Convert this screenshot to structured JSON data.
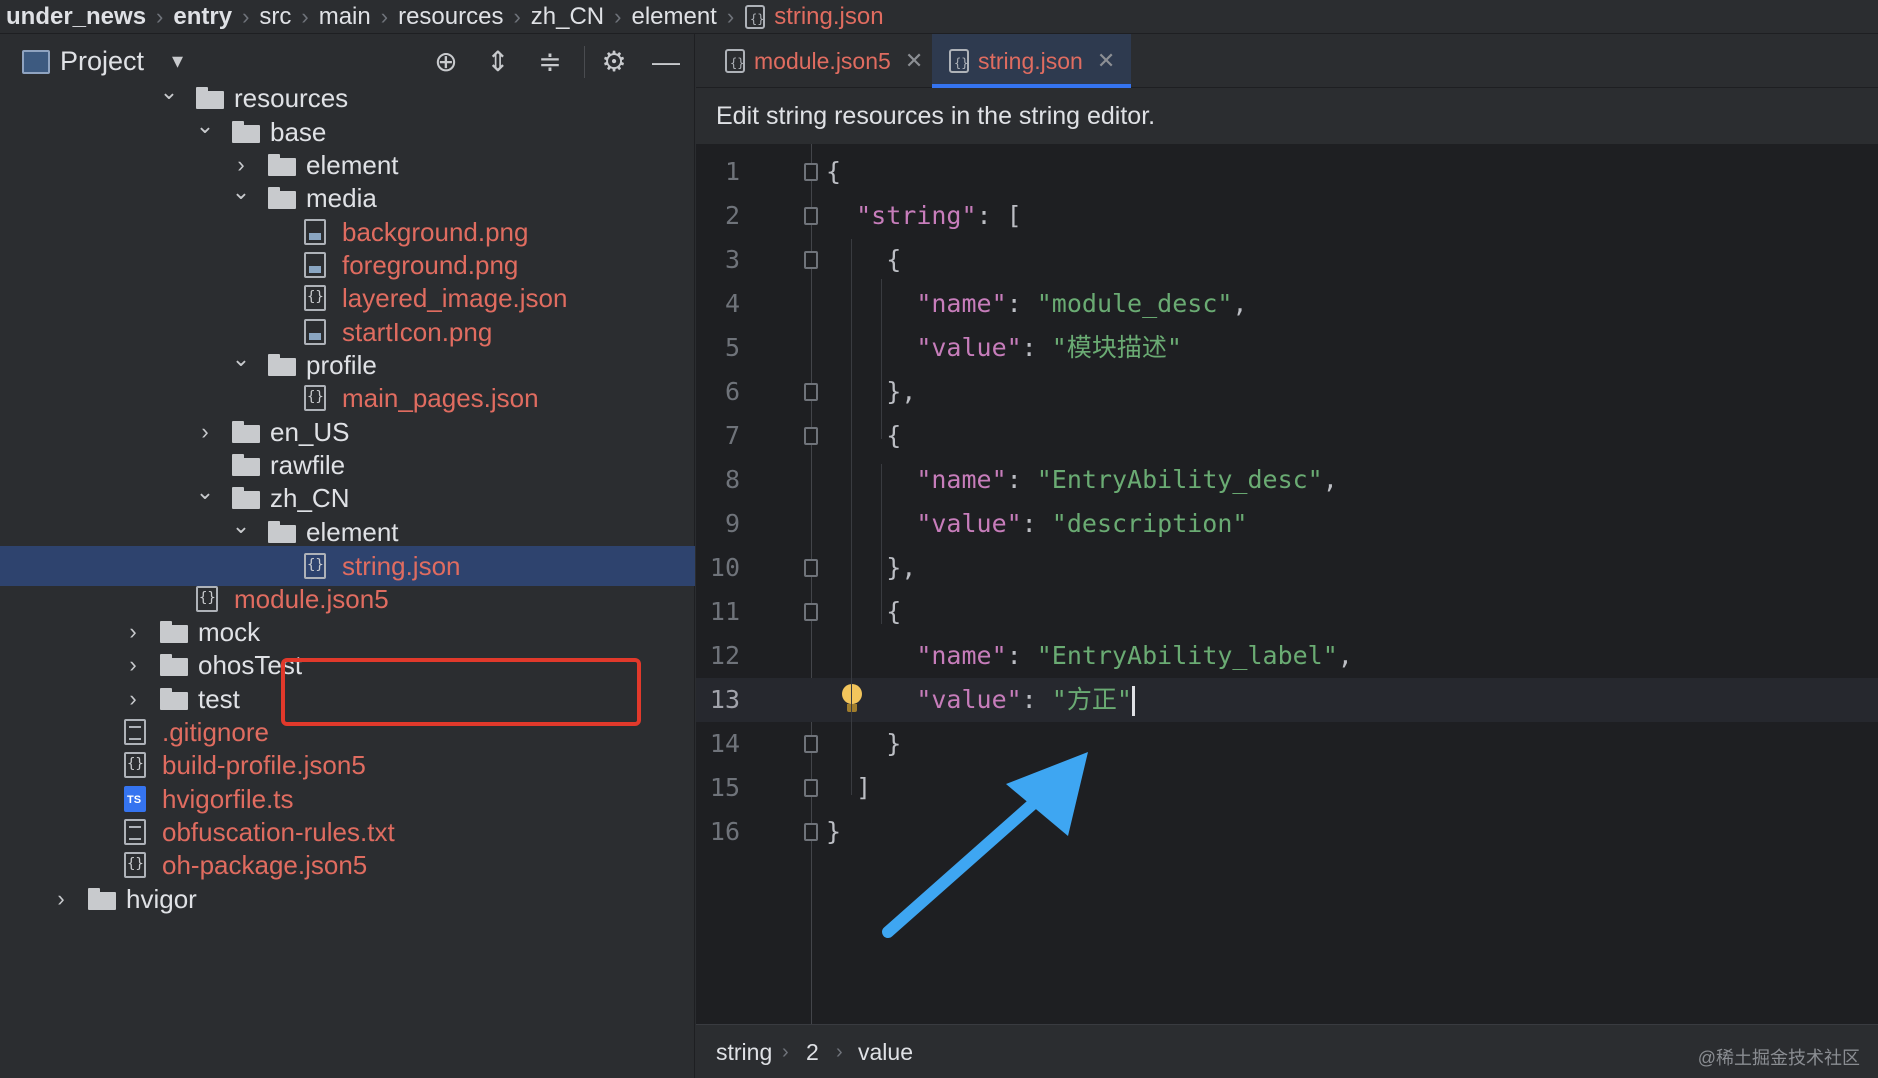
{
  "breadcrumb": {
    "items": [
      "under_news",
      "entry",
      "src",
      "main",
      "resources",
      "zh_CN",
      "element"
    ],
    "file": "string.json"
  },
  "project_panel": {
    "title": "Project",
    "tree": [
      {
        "label": "resources",
        "kind": "folder",
        "state": "expanded"
      },
      {
        "label": "base",
        "kind": "folder",
        "state": "expanded"
      },
      {
        "label": "element",
        "kind": "folder",
        "state": "collapsed"
      },
      {
        "label": "media",
        "kind": "folder",
        "state": "expanded"
      },
      {
        "label": "background.png",
        "kind": "image-file"
      },
      {
        "label": "foreground.png",
        "kind": "image-file"
      },
      {
        "label": "layered_image.json",
        "kind": "json-file"
      },
      {
        "label": "startIcon.png",
        "kind": "image-file"
      },
      {
        "label": "profile",
        "kind": "folder",
        "state": "expanded"
      },
      {
        "label": "main_pages.json",
        "kind": "json-file"
      },
      {
        "label": "en_US",
        "kind": "folder",
        "state": "collapsed"
      },
      {
        "label": "rawfile",
        "kind": "folder"
      },
      {
        "label": "zh_CN",
        "kind": "folder",
        "state": "expanded"
      },
      {
        "label": "element",
        "kind": "folder",
        "state": "expanded"
      },
      {
        "label": "string.json",
        "kind": "json-file",
        "selected": true
      },
      {
        "label": "module.json5",
        "kind": "json-file"
      },
      {
        "label": "mock",
        "kind": "folder",
        "state": "collapsed"
      },
      {
        "label": "ohosTest",
        "kind": "folder",
        "state": "collapsed"
      },
      {
        "label": "test",
        "kind": "folder",
        "state": "collapsed"
      },
      {
        "label": ".gitignore",
        "kind": "text-file"
      },
      {
        "label": "build-profile.json5",
        "kind": "json-file"
      },
      {
        "label": "hvigorfile.ts",
        "kind": "ts-file"
      },
      {
        "label": "obfuscation-rules.txt",
        "kind": "text-file"
      },
      {
        "label": "oh-package.json5",
        "kind": "json-file"
      },
      {
        "label": "hvigor",
        "kind": "folder",
        "state": "collapsed"
      }
    ]
  },
  "editor": {
    "tabs": [
      {
        "label": "module.json5",
        "active": false
      },
      {
        "label": "string.json",
        "active": true
      }
    ],
    "notice": "Edit string resources in the string editor.",
    "current_line": 13,
    "lines": [
      {
        "n": "1",
        "t": "{"
      },
      {
        "n": "2",
        "t": "  \"string\": ["
      },
      {
        "n": "3",
        "t": "    {"
      },
      {
        "n": "4",
        "t": "      \"name\": \"module_desc\","
      },
      {
        "n": "5",
        "t": "      \"value\": \"模块描述\""
      },
      {
        "n": "6",
        "t": "    },"
      },
      {
        "n": "7",
        "t": "    {"
      },
      {
        "n": "8",
        "t": "      \"name\": \"EntryAbility_desc\","
      },
      {
        "n": "9",
        "t": "      \"value\": \"description\""
      },
      {
        "n": "10",
        "t": "    },"
      },
      {
        "n": "11",
        "t": "    {"
      },
      {
        "n": "12",
        "t": "      \"name\": \"EntryAbility_label\","
      },
      {
        "n": "13",
        "t": "      \"value\": \"方正\""
      },
      {
        "n": "14",
        "t": "    }"
      },
      {
        "n": "15",
        "t": "  ]"
      },
      {
        "n": "16",
        "t": "}"
      }
    ],
    "status_path": [
      "string",
      "2",
      "value"
    ]
  },
  "watermark": "@稀土掘金技术社区",
  "colors": {
    "modified_file": "#e06c60",
    "selection": "#2e436e",
    "highlight_box": "#e1392b",
    "arrow": "#3ea6f2"
  }
}
